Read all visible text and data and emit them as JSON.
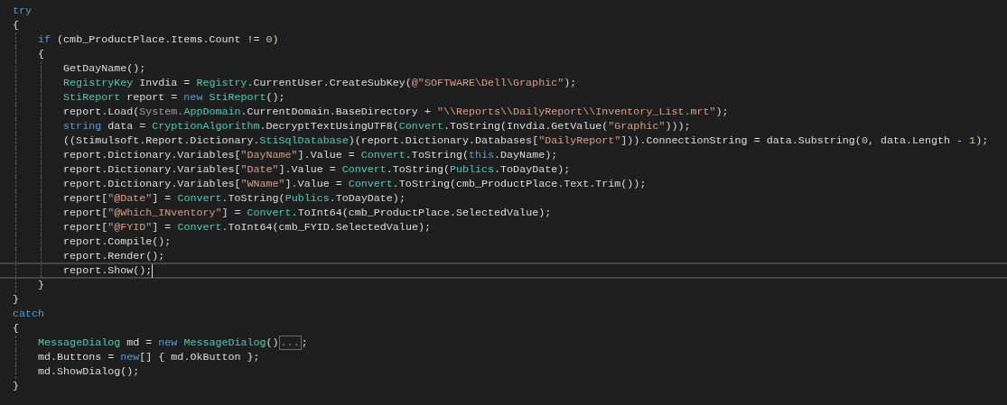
{
  "editor": {
    "lines": [
      {
        "current": false,
        "tokens": [
          {
            "kind": "keyword",
            "text": "try"
          }
        ]
      },
      {
        "current": false,
        "tokens": [
          {
            "kind": "plain",
            "text": "{"
          }
        ],
        "children": [
          {
            "current": false,
            "tokens": [
              {
                "kind": "keyword",
                "text": "if"
              },
              {
                "kind": "plain",
                "text": " (cmb_ProductPlace.Items.Count != "
              },
              {
                "kind": "number",
                "text": "0"
              },
              {
                "kind": "plain",
                "text": ")"
              }
            ]
          },
          {
            "current": false,
            "tokens": [
              {
                "kind": "plain",
                "text": "{"
              }
            ],
            "children": [
              {
                "current": false,
                "tokens": [
                  {
                    "kind": "plain",
                    "text": "GetDayName();"
                  }
                ]
              },
              {
                "current": false,
                "tokens": [
                  {
                    "kind": "type",
                    "text": "RegistryKey"
                  },
                  {
                    "kind": "plain",
                    "text": " Invdia = "
                  },
                  {
                    "kind": "type",
                    "text": "Registry"
                  },
                  {
                    "kind": "plain",
                    "text": ".CurrentUser.CreateSubKey("
                  },
                  {
                    "kind": "string",
                    "text": "@\"SOFTWARE\\Dell\\Graphic\""
                  },
                  {
                    "kind": "plain",
                    "text": ");"
                  }
                ]
              },
              {
                "current": false,
                "tokens": [
                  {
                    "kind": "type",
                    "text": "StiReport"
                  },
                  {
                    "kind": "plain",
                    "text": " report = "
                  },
                  {
                    "kind": "keyword",
                    "text": "new"
                  },
                  {
                    "kind": "type",
                    "text": " StiReport"
                  },
                  {
                    "kind": "plain",
                    "text": "();"
                  }
                ]
              },
              {
                "current": false,
                "tokens": [
                  {
                    "kind": "plain",
                    "text": "report.Load("
                  },
                  {
                    "kind": "dim",
                    "text": "System."
                  },
                  {
                    "kind": "type",
                    "text": "AppDomain"
                  },
                  {
                    "kind": "plain",
                    "text": ".CurrentDomain.BaseDirectory + "
                  },
                  {
                    "kind": "string",
                    "text": "\"\\\\Reports\\\\DailyReport\\\\Inventory_List.mrt\""
                  },
                  {
                    "kind": "plain",
                    "text": ");"
                  }
                ]
              },
              {
                "current": false,
                "tokens": [
                  {
                    "kind": "keyword",
                    "text": "string"
                  },
                  {
                    "kind": "plain",
                    "text": " data = "
                  },
                  {
                    "kind": "type",
                    "text": "CryptionAlgorithm"
                  },
                  {
                    "kind": "plain",
                    "text": ".DecryptTextUsingUTF8("
                  },
                  {
                    "kind": "type",
                    "text": "Convert"
                  },
                  {
                    "kind": "plain",
                    "text": ".ToString(Invdia.GetValue("
                  },
                  {
                    "kind": "string",
                    "text": "\"Graphic\""
                  },
                  {
                    "kind": "plain",
                    "text": ")));"
                  }
                ]
              },
              {
                "current": false,
                "tokens": [
                  {
                    "kind": "plain",
                    "text": "((Stimulsoft.Report.Dictionary."
                  },
                  {
                    "kind": "type",
                    "text": "StiSqlDatabase"
                  },
                  {
                    "kind": "plain",
                    "text": ")(report.Dictionary.Databases["
                  },
                  {
                    "kind": "string",
                    "text": "\"DailyReport\""
                  },
                  {
                    "kind": "plain",
                    "text": "])).ConnectionString = data.Substring("
                  },
                  {
                    "kind": "number",
                    "text": "0"
                  },
                  {
                    "kind": "plain",
                    "text": ", data.Length - "
                  },
                  {
                    "kind": "number",
                    "text": "1"
                  },
                  {
                    "kind": "plain",
                    "text": ");"
                  }
                ]
              },
              {
                "current": false,
                "tokens": [
                  {
                    "kind": "plain",
                    "text": "report.Dictionary.Variables["
                  },
                  {
                    "kind": "string",
                    "text": "\"DayName\""
                  },
                  {
                    "kind": "plain",
                    "text": "].Value = "
                  },
                  {
                    "kind": "type",
                    "text": "Convert"
                  },
                  {
                    "kind": "plain",
                    "text": ".ToString("
                  },
                  {
                    "kind": "keyword",
                    "text": "this"
                  },
                  {
                    "kind": "plain",
                    "text": ".DayName);"
                  }
                ]
              },
              {
                "current": false,
                "tokens": [
                  {
                    "kind": "plain",
                    "text": "report.Dictionary.Variables["
                  },
                  {
                    "kind": "string",
                    "text": "\"Date\""
                  },
                  {
                    "kind": "plain",
                    "text": "].Value = "
                  },
                  {
                    "kind": "type",
                    "text": "Convert"
                  },
                  {
                    "kind": "plain",
                    "text": ".ToString("
                  },
                  {
                    "kind": "type",
                    "text": "Publics"
                  },
                  {
                    "kind": "plain",
                    "text": ".ToDayDate);"
                  }
                ]
              },
              {
                "current": false,
                "tokens": [
                  {
                    "kind": "plain",
                    "text": "report.Dictionary.Variables["
                  },
                  {
                    "kind": "string",
                    "text": "\"WName\""
                  },
                  {
                    "kind": "plain",
                    "text": "].Value = "
                  },
                  {
                    "kind": "type",
                    "text": "Convert"
                  },
                  {
                    "kind": "plain",
                    "text": ".ToString(cmb_ProductPlace.Text.Trim());"
                  }
                ]
              },
              {
                "current": false,
                "tokens": [
                  {
                    "kind": "plain",
                    "text": "report["
                  },
                  {
                    "kind": "string",
                    "text": "\"@Date\""
                  },
                  {
                    "kind": "plain",
                    "text": "] = "
                  },
                  {
                    "kind": "type",
                    "text": "Convert"
                  },
                  {
                    "kind": "plain",
                    "text": ".ToString("
                  },
                  {
                    "kind": "type",
                    "text": "Publics"
                  },
                  {
                    "kind": "plain",
                    "text": ".ToDayDate);"
                  }
                ]
              },
              {
                "current": false,
                "tokens": [
                  {
                    "kind": "plain",
                    "text": "report["
                  },
                  {
                    "kind": "string",
                    "text": "\"@Which_INventory\""
                  },
                  {
                    "kind": "plain",
                    "text": "] = "
                  },
                  {
                    "kind": "type",
                    "text": "Convert"
                  },
                  {
                    "kind": "plain",
                    "text": ".ToInt64(cmb_ProductPlace.SelectedValue);"
                  }
                ]
              },
              {
                "current": false,
                "tokens": [
                  {
                    "kind": "plain",
                    "text": "report["
                  },
                  {
                    "kind": "string",
                    "text": "\"@FYID\""
                  },
                  {
                    "kind": "plain",
                    "text": "] = "
                  },
                  {
                    "kind": "type",
                    "text": "Convert"
                  },
                  {
                    "kind": "plain",
                    "text": ".ToInt64(cmb_FYID.SelectedValue);"
                  }
                ]
              },
              {
                "current": false,
                "tokens": [
                  {
                    "kind": "plain",
                    "text": "report.Compile();"
                  }
                ]
              },
              {
                "current": false,
                "tokens": [
                  {
                    "kind": "plain",
                    "text": "report.Render();"
                  }
                ]
              },
              {
                "current": true,
                "tokens": [
                  {
                    "kind": "plain",
                    "text": "report.Show();"
                  }
                ]
              }
            ]
          },
          {
            "current": false,
            "tokens": [
              {
                "kind": "plain",
                "text": "}"
              }
            ]
          }
        ]
      },
      {
        "current": false,
        "tokens": [
          {
            "kind": "plain",
            "text": "}"
          }
        ]
      },
      {
        "current": false,
        "tokens": [
          {
            "kind": "keyword",
            "text": "catch"
          }
        ]
      },
      {
        "current": false,
        "tokens": [
          {
            "kind": "plain",
            "text": "{"
          }
        ],
        "children": [
          {
            "current": false,
            "tokens": [
              {
                "kind": "type",
                "text": "MessageDialog"
              },
              {
                "kind": "plain",
                "text": " md = "
              },
              {
                "kind": "keyword",
                "text": "new"
              },
              {
                "kind": "type",
                "text": " MessageDialog"
              },
              {
                "kind": "plain",
                "text": "()"
              },
              {
                "kind": "collapsed",
                "text": "..."
              },
              {
                "kind": "plain",
                "text": ";"
              }
            ]
          },
          {
            "current": false,
            "tokens": [
              {
                "kind": "plain",
                "text": "md.Buttons = "
              },
              {
                "kind": "keyword",
                "text": "new"
              },
              {
                "kind": "plain",
                "text": "[] { md.OkButton };"
              }
            ]
          },
          {
            "current": false,
            "tokens": [
              {
                "kind": "plain",
                "text": "md.ShowDialog();"
              }
            ]
          }
        ]
      },
      {
        "current": false,
        "tokens": [
          {
            "kind": "plain",
            "text": "}"
          }
        ]
      }
    ]
  }
}
